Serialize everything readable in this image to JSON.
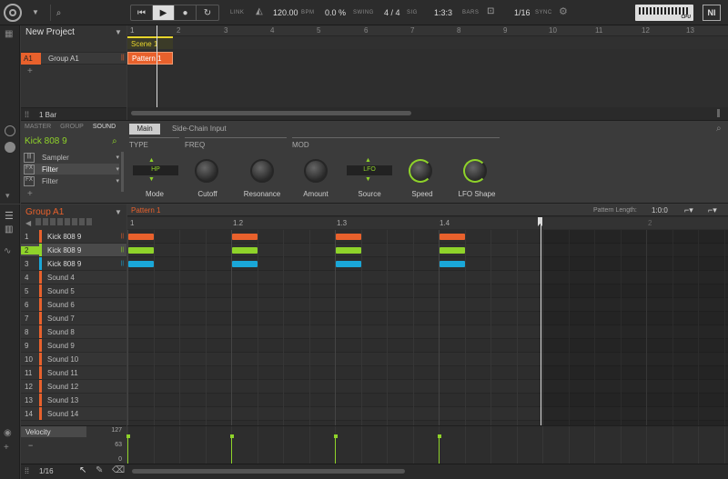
{
  "transport": {
    "link": "LINK",
    "tempo": "120.00",
    "tempo_unit": "BPM",
    "swing": "0.0 %",
    "swing_label": "SWING",
    "signature": "4 / 4",
    "signature_label": "SIG",
    "position": "1:3:3",
    "position_label": "BARS",
    "quantize": "1/16",
    "sync_label": "SYNC",
    "cpu_label": "CPU"
  },
  "arranger": {
    "project_name": "New Project",
    "group_index": "A1",
    "group_name": "Group A1",
    "add_label": "+",
    "bars_label": "1 Bar",
    "ruler": [
      "1",
      "2",
      "3",
      "4",
      "5",
      "6",
      "7",
      "8",
      "9",
      "10",
      "11",
      "12",
      "13"
    ],
    "scene_name": "Scene 1",
    "pattern_name": "Pattern 1"
  },
  "control": {
    "tabs": [
      "MASTER",
      "GROUP",
      "SOUND"
    ],
    "sound_name": "Kick 808 9",
    "plugins": [
      {
        "icon": "|||",
        "name": "Sampler"
      },
      {
        "icon": "FX",
        "name": "Filter"
      },
      {
        "icon": "FX",
        "name": "Filter"
      }
    ],
    "add_label": "+",
    "page_tabs": [
      "Main",
      "Side-Chain Input"
    ],
    "sections": [
      "TYPE",
      "FREQ",
      "MOD"
    ],
    "mode_value": "HP",
    "source_value": "LFO",
    "params": [
      "Mode",
      "Cutoff",
      "Resonance",
      "Amount",
      "Source",
      "Speed",
      "LFO Shape"
    ]
  },
  "pattern": {
    "group_name": "Group A1",
    "pattern_name": "Pattern 1",
    "length_label": "Pattern Length:",
    "length_value": "1:0:0",
    "ruler": [
      "1",
      "1.2",
      "1.3",
      "1.4",
      "2"
    ],
    "sounds": [
      {
        "n": "1",
        "name": "Kick 808 9",
        "color": "#e8612c"
      },
      {
        "n": "2",
        "name": "Kick 808 9",
        "color": "#8fd32a"
      },
      {
        "n": "3",
        "name": "Kick 808 9",
        "color": "#1aa7d8"
      },
      {
        "n": "4",
        "name": "Sound 4",
        "color": "#e8612c"
      },
      {
        "n": "5",
        "name": "Sound 5",
        "color": "#e8612c"
      },
      {
        "n": "6",
        "name": "Sound 6",
        "color": "#e8612c"
      },
      {
        "n": "7",
        "name": "Sound 7",
        "color": "#e8612c"
      },
      {
        "n": "8",
        "name": "Sound 8",
        "color": "#e8612c"
      },
      {
        "n": "9",
        "name": "Sound 9",
        "color": "#e8612c"
      },
      {
        "n": "10",
        "name": "Sound 10",
        "color": "#e8612c"
      },
      {
        "n": "11",
        "name": "Sound 11",
        "color": "#e8612c"
      },
      {
        "n": "12",
        "name": "Sound 12",
        "color": "#e8612c"
      },
      {
        "n": "13",
        "name": "Sound 13",
        "color": "#e8612c"
      },
      {
        "n": "14",
        "name": "Sound 14",
        "color": "#e8612c"
      }
    ],
    "notes": [
      {
        "row": 0,
        "beats": [
          0,
          1,
          2,
          3
        ],
        "color": "#e8612c"
      },
      {
        "row": 1,
        "beats": [
          0,
          1,
          2,
          3
        ],
        "color": "#8fd32a"
      },
      {
        "row": 2,
        "beats": [
          0,
          1,
          2,
          3
        ],
        "color": "#1aa7d8"
      }
    ]
  },
  "velocity": {
    "label": "Velocity",
    "max": "127",
    "mid": "63",
    "min": "0",
    "minus": "−"
  },
  "footer": {
    "grid": "1/16"
  },
  "colors": {
    "accent_orange": "#e8612c",
    "accent_green": "#8fd32a",
    "accent_blue": "#1aa7d8",
    "scene_yellow": "#e8d52c"
  }
}
